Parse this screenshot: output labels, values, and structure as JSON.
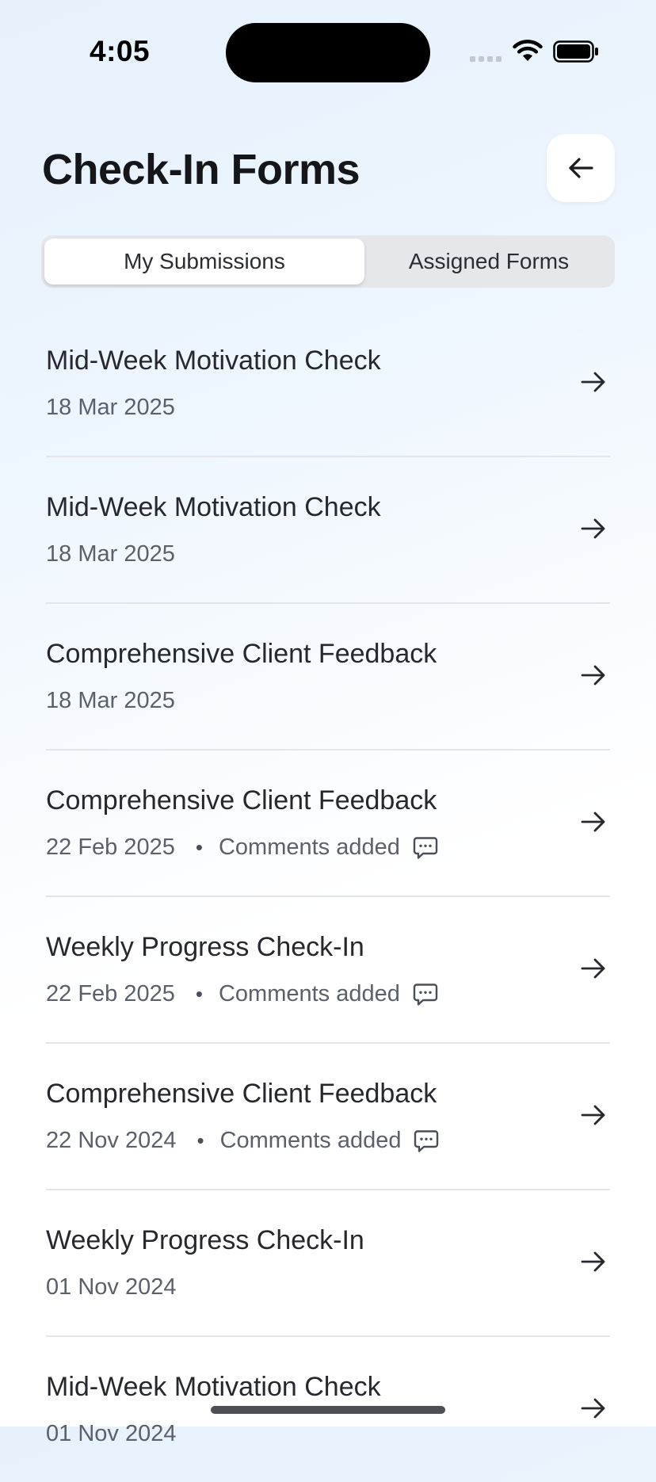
{
  "status_bar": {
    "time": "4:05"
  },
  "header": {
    "title": "Check-In Forms",
    "back_icon": "arrow-left-icon"
  },
  "tabs": [
    {
      "label": "My Submissions",
      "active": true
    },
    {
      "label": "Assigned Forms",
      "active": false
    }
  ],
  "submissions": [
    {
      "title": "Mid-Week Motivation Check",
      "date": "18 Mar 2025"
    },
    {
      "title": "Mid-Week Motivation Check",
      "date": "18 Mar 2025"
    },
    {
      "title": "Comprehensive Client Feedback",
      "date": "18 Mar 2025"
    },
    {
      "title": "Comprehensive Client Feedback",
      "date": "22 Feb 2025",
      "separator": "•",
      "comments": "Comments added"
    },
    {
      "title": "Weekly Progress Check-In",
      "date": "22 Feb 2025",
      "separator": "•",
      "comments": "Comments added"
    },
    {
      "title": "Comprehensive Client Feedback",
      "date": "22 Nov 2024",
      "separator": "•",
      "comments": "Comments added"
    },
    {
      "title": "Weekly Progress Check-In",
      "date": "01 Nov 2024"
    },
    {
      "title": "Mid-Week Motivation Check",
      "date": "01 Nov 2024"
    }
  ],
  "colors": {
    "accent_text": "#14161a",
    "secondary_text": "#5c606a",
    "divider": "#e3e5e9",
    "segment_bg": "#e6e7ea"
  },
  "icons": {
    "row_action": "arrow-right-icon",
    "comments": "comment-bubble-icon"
  }
}
